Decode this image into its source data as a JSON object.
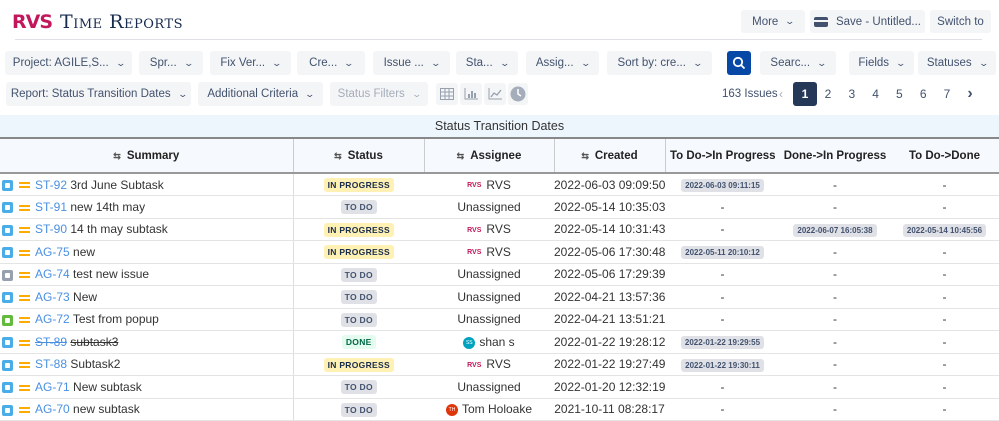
{
  "app": {
    "logo": "RVS",
    "title": "Time Reports"
  },
  "top": {
    "more": "More",
    "save": "Save - Untitled...",
    "switch": "Switch to"
  },
  "filters": [
    "Project: AGILE,S...",
    "Spr...",
    "Fix Ver...",
    "Cre...",
    "Issue ...",
    "Sta...",
    "Assig...",
    "Sort by: cre..."
  ],
  "search_filter": "Searc...",
  "fields": "Fields",
  "statuses": "Statuses",
  "row2": {
    "report": "Report: Status Transition Dates",
    "additional": "Additional Criteria",
    "status_filters": "Status Filters"
  },
  "pagination": {
    "count": "163 Issues",
    "pages": [
      "1",
      "2",
      "3",
      "4",
      "5",
      "6",
      "7"
    ],
    "current": "1"
  },
  "table": {
    "title": "Status Transition Dates",
    "columns": [
      "Summary",
      "Status",
      "Assignee",
      "Created",
      "To Do->In Progress",
      "Done->In Progress",
      "To Do->Done"
    ],
    "rows": [
      {
        "type": "subtask",
        "key": "ST-92",
        "summary": "3rd June Subtask",
        "status": "IN PROGRESS",
        "assignee": "RVS",
        "created": "2022-06-03 09:09:50",
        "c1": "2022-06-03 09:11:15",
        "c2": "-",
        "c3": "-"
      },
      {
        "type": "subtask",
        "key": "ST-91",
        "summary": "new 14th may",
        "status": "TO DO",
        "assignee": "Unassigned",
        "created": "2022-05-14 10:35:03",
        "c1": "-",
        "c2": "-",
        "c3": "-"
      },
      {
        "type": "subtask",
        "key": "ST-90",
        "summary": "14 th may subtask",
        "status": "IN PROGRESS",
        "assignee": "RVS",
        "created": "2022-05-14 10:31:43",
        "c1": "-",
        "c2": "2022-06-07 16:05:38",
        "c3": "2022-05-14 10:45:56"
      },
      {
        "type": "subtask",
        "key": "AG-75",
        "summary": "new",
        "status": "IN PROGRESS",
        "assignee": "RVS",
        "created": "2022-05-06 17:30:48",
        "c1": "2022-05-11 20:10:12",
        "c2": "-",
        "c3": "-"
      },
      {
        "type": "other",
        "key": "AG-74",
        "summary": "test new issue",
        "status": "TO DO",
        "assignee": "Unassigned",
        "created": "2022-05-06 17:29:39",
        "c1": "-",
        "c2": "-",
        "c3": "-"
      },
      {
        "type": "task",
        "key": "AG-73",
        "summary": "New",
        "status": "TO DO",
        "assignee": "Unassigned",
        "created": "2022-04-21 13:57:36",
        "c1": "-",
        "c2": "-",
        "c3": "-"
      },
      {
        "type": "story",
        "key": "AG-72",
        "summary": "Test from popup",
        "status": "TO DO",
        "assignee": "Unassigned",
        "created": "2022-04-21 13:51:21",
        "c1": "-",
        "c2": "-",
        "c3": "-"
      },
      {
        "type": "subtask",
        "key": "ST-89",
        "summary": "subtask3",
        "status": "DONE",
        "assignee": "shan s",
        "avatar": "SS",
        "created": "2022-01-22 19:28:12",
        "c1": "2022-01-22 19:29:55",
        "c2": "-",
        "c3": "-"
      },
      {
        "type": "subtask",
        "key": "ST-88",
        "summary": "Subtask2",
        "status": "IN PROGRESS",
        "assignee": "RVS",
        "created": "2022-01-22 19:27:49",
        "c1": "2022-01-22 19:30:11",
        "c2": "-",
        "c3": "-"
      },
      {
        "type": "subtask",
        "key": "AG-71",
        "summary": "New subtask",
        "status": "TO DO",
        "assignee": "Unassigned",
        "created": "2022-01-20 12:32:19",
        "c1": "-",
        "c2": "-",
        "c3": "-"
      },
      {
        "type": "subtask",
        "key": "AG-70",
        "summary": "new subtask",
        "status": "TO DO",
        "assignee": "Tom Holoake",
        "avatar": "TH",
        "created": "2021-10-11 08:28:17",
        "c1": "-",
        "c2": "-",
        "c3": "-"
      }
    ]
  },
  "colors": {
    "accent": "#0747a6",
    "active_page": "#253858",
    "link": "#4a90e2"
  }
}
